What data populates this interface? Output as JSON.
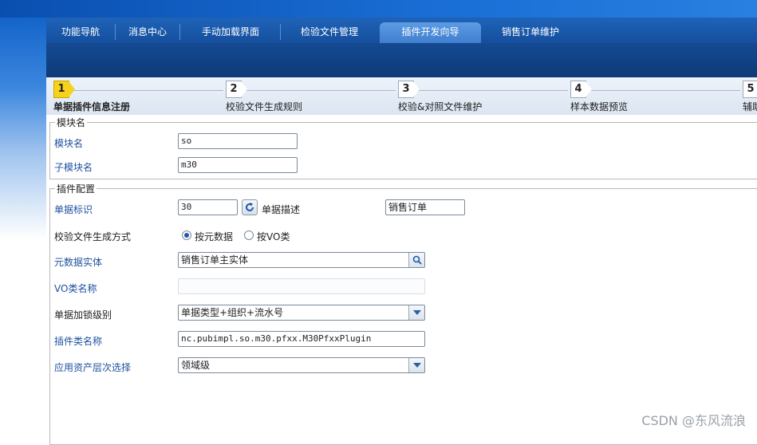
{
  "tabs": [
    {
      "label": "功能导航"
    },
    {
      "label": "消息中心"
    },
    {
      "label": "手动加载界面"
    },
    {
      "label": "检验文件管理"
    },
    {
      "label": "插件开发向导",
      "active": true
    },
    {
      "label": "销售订单维护"
    }
  ],
  "wizard": {
    "steps": [
      {
        "number": "1",
        "label": "单据插件信息注册",
        "active": true
      },
      {
        "number": "2",
        "label": "校验文件生成规则"
      },
      {
        "number": "3",
        "label": "校验&对照文件维护"
      },
      {
        "number": "4",
        "label": "样本数据预览"
      },
      {
        "number": "5",
        "label": "辅助"
      }
    ]
  },
  "module_group": {
    "legend": "模块名",
    "module_name_label": "模块名",
    "module_name_value": "so",
    "submodule_name_label": "子模块名",
    "submodule_name_value": "m30"
  },
  "plugin_group": {
    "legend": "插件配置",
    "bill_id_label": "单据标识",
    "bill_id_value": "30",
    "bill_desc_label": "单据描述",
    "bill_desc_value": "销售订单",
    "gen_mode_label": "校验文件生成方式",
    "gen_mode_options": [
      {
        "label": "按元数据",
        "checked": true
      },
      {
        "label": "按VO类",
        "checked": false
      }
    ],
    "metadata_entity_label": "元数据实体",
    "metadata_entity_value": "销售订单主实体",
    "vo_class_label": "VO类名称",
    "vo_class_value": "",
    "lock_level_label": "单据加锁级别",
    "lock_level_value": "单据类型+组织+流水号",
    "plugin_class_label": "插件类名称",
    "plugin_class_value": "nc.pubimpl.so.m30.pfxx.M30PfxxPlugin",
    "asset_level_label": "应用资产层次选择",
    "asset_level_value": "领域级"
  },
  "watermark": "CSDN @东风流浪",
  "colors": {
    "tab_bar": "#1f63b8",
    "active_tab": "#4f8fdc",
    "active_step": "#f6d21c",
    "label_blue": "#1d4f9e"
  },
  "icons": [
    "refresh-icon",
    "search-icon",
    "chevron-down-icon"
  ]
}
